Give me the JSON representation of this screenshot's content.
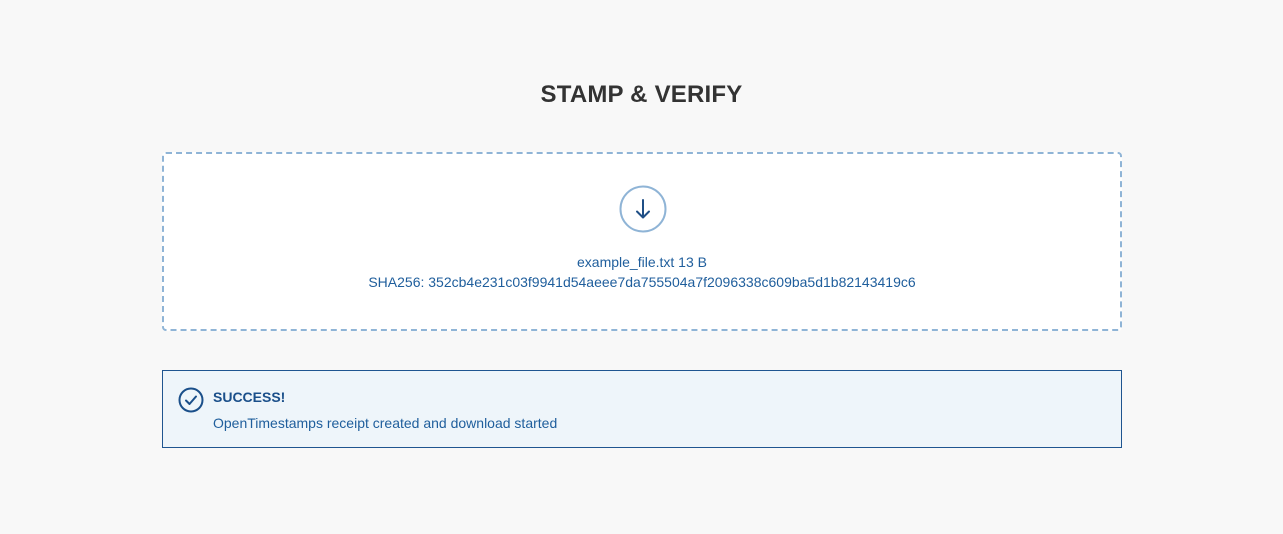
{
  "header": {
    "title": "STAMP & VERIFY"
  },
  "dropzone": {
    "icon": "arrow-down-circle-icon",
    "file_info": "example_file.txt 13 B",
    "file_hash": "SHA256: 352cb4e231c03f9941d54aeee7da755504a7f2096338c609ba5d1b82143419c6"
  },
  "alert": {
    "icon": "check-circle-icon",
    "title": "SUCCESS!",
    "message": "OpenTimestamps receipt created and download started"
  },
  "colors": {
    "background": "#f8f8f8",
    "accent": "#1f5e9c",
    "dropzone_border": "#8fb4d6",
    "alert_background": "#eef5fa",
    "alert_border": "#1f5590"
  }
}
